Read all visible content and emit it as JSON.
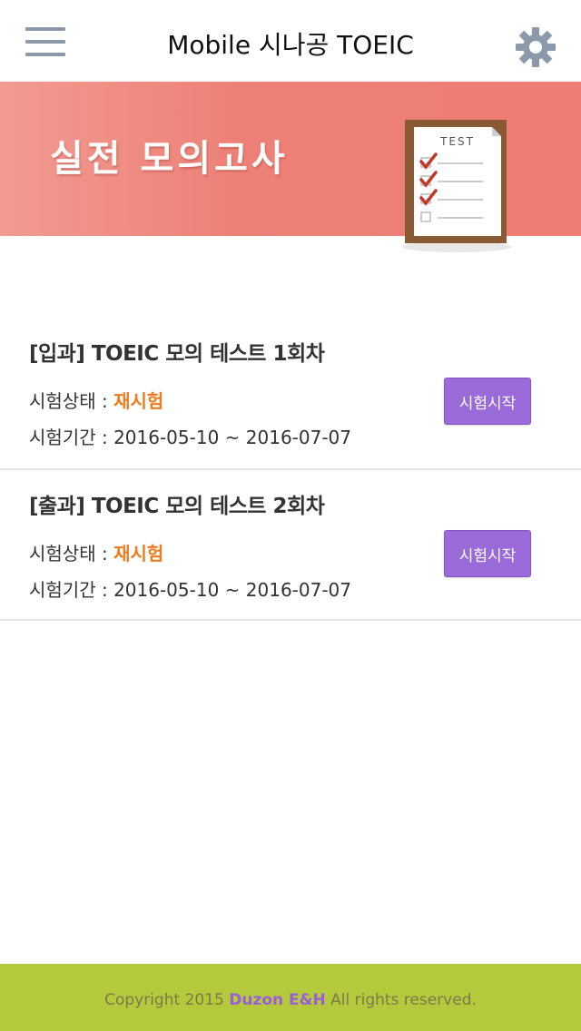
{
  "header": {
    "title": "Mobile 시나공 TOEIC",
    "menu_icon": "hamburger-menu-icon",
    "settings_icon": "gear-icon"
  },
  "banner": {
    "title": "실전 모의고사",
    "icon_label": "TEST",
    "colors": {
      "banner": "#ee8177"
    }
  },
  "exams": [
    {
      "title": "[입과] TOEIC 모의 테스트 1회차",
      "status_label": "시험상태 : ",
      "status": "재시험",
      "period_label": "시험기간 : ",
      "period": "2016-05-10 ~ 2016-07-07",
      "start_label": "시험시작"
    },
    {
      "title": "[출과] TOEIC 모의 테스트 2회차",
      "status_label": "시험상태 : ",
      "status": "재시험",
      "period_label": "시험기간 : ",
      "period": "2016-05-10 ~ 2016-07-07",
      "start_label": "시험시작"
    }
  ],
  "footer": {
    "prefix": "Copyright 2015 ",
    "brand": "Duzon E&H",
    "suffix": " All rights reserved.",
    "colors": {
      "background": "#b4c93c",
      "brand": "#9a5fd8"
    }
  },
  "colors": {
    "status": "#f07a1e",
    "button": "#9a6bd8"
  }
}
